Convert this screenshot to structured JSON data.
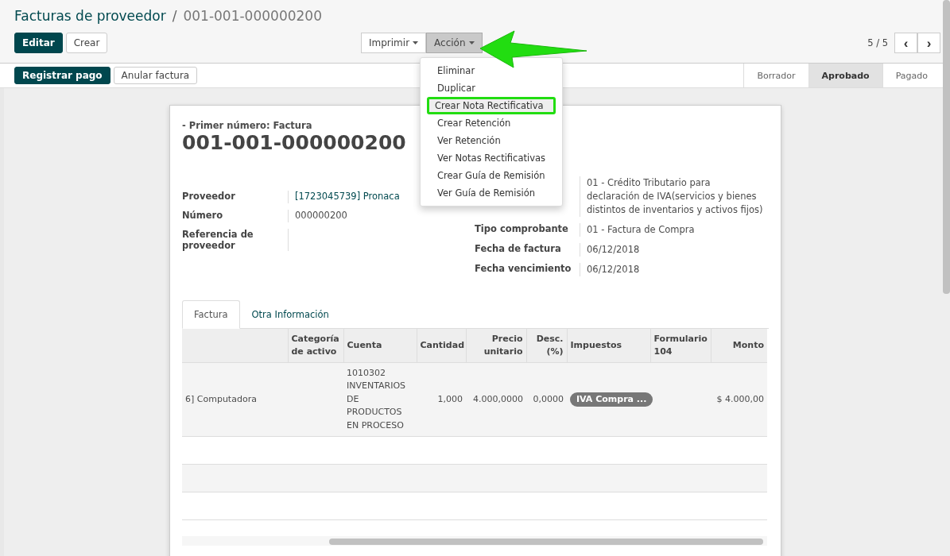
{
  "breadcrumb": {
    "parent": "Facturas de proveedor",
    "separator": "/",
    "current": "001-001-000000200"
  },
  "main_buttons": [
    {
      "label": "Editar",
      "kind": "primary"
    },
    {
      "label": "Crear",
      "kind": "default"
    }
  ],
  "dropdowns": [
    {
      "label": "Imprimir",
      "open": false
    },
    {
      "label": "Acción",
      "open": true
    }
  ],
  "action_menu": [
    {
      "label": "Eliminar",
      "selected": false
    },
    {
      "label": "Duplicar",
      "selected": false
    },
    {
      "label": "Crear Nota Rectificativa",
      "selected": true
    },
    {
      "label": "Crear Retención",
      "selected": false
    },
    {
      "label": "Ver Retención",
      "selected": false
    },
    {
      "label": "Ver Notas Rectificativas",
      "selected": false
    },
    {
      "label": "Crear Guía de Remisión",
      "selected": false
    },
    {
      "label": "Ver Guía de Remisión",
      "selected": false
    }
  ],
  "pager": {
    "text": "5 / 5",
    "prev": "‹",
    "next": "›"
  },
  "status_buttons": [
    {
      "label": "Registrar pago",
      "kind": "primary"
    },
    {
      "label": "Anular factura",
      "kind": "default"
    }
  ],
  "stages": [
    {
      "label": "Borrador",
      "selected": false
    },
    {
      "label": "Aprobado",
      "selected": true
    },
    {
      "label": "Pagado",
      "selected": false
    }
  ],
  "sheet": {
    "subtitle": "- Primer número: Factura",
    "title": "001-001-000000200",
    "left_fields": [
      {
        "label": "Proveedor",
        "value": "[1723045739] Pronaca",
        "kind": "link"
      },
      {
        "label": "Número",
        "value": "000000200",
        "kind": "text"
      },
      {
        "label": "Referencia de proveedor"
      }
    ],
    "right_fields": [
      {
        "value": "01 - Crédito Tributario para declaración de IVA(servicios y bienes distintos de inventarios y activos fijos)"
      },
      {
        "label": "Tipo comprobante",
        "value": "01 - Factura de Compra"
      },
      {
        "label": "Fecha de factura",
        "value": "06/12/2018"
      },
      {
        "label": "Fecha vencimiento",
        "value": "06/12/2018"
      }
    ]
  },
  "tabs": [
    {
      "label": "Factura",
      "selected": true
    },
    {
      "label": "Otra Información",
      "selected": false
    }
  ],
  "table": {
    "columns": [
      "",
      "Categoría de activo",
      "Cuenta",
      "Cantidad",
      "Precio unitario",
      "Desc. (%)",
      "Impuestos",
      "Formulario 104",
      "Monto"
    ],
    "rows": [
      {
        "column_1": "6] Computadora",
        "categoria": "",
        "cuenta": "1010302 INVENTARIOS DE PRODUCTOS EN PROCESO",
        "cantidad": "1,000",
        "precio": "4.000,0000",
        "desc": "0,0000",
        "impuestos": "IVA Compra ...",
        "formulario": "",
        "monto": "$ 4.000,00"
      }
    ]
  }
}
